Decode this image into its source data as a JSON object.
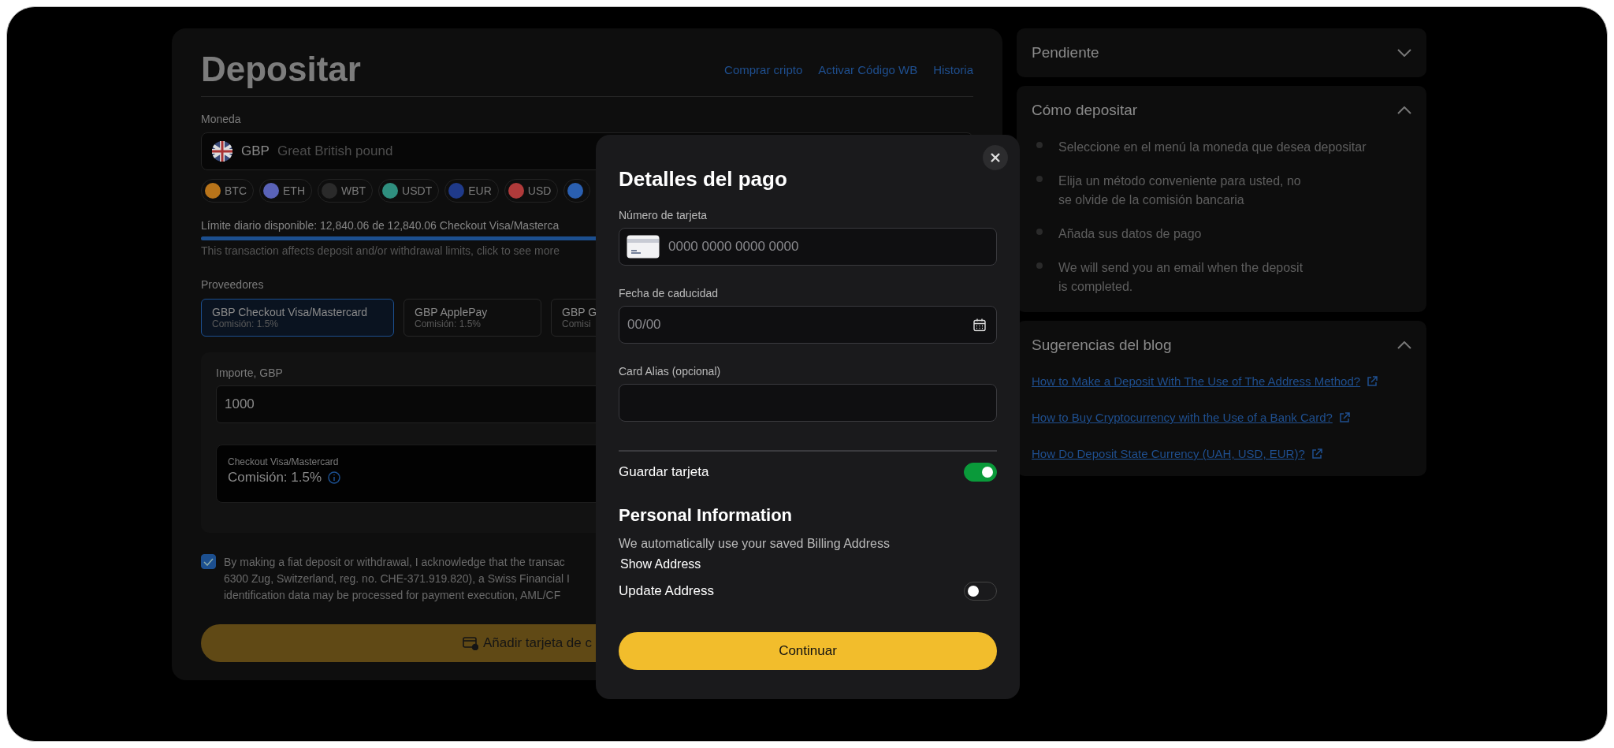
{
  "deposit": {
    "title": "Depositar",
    "links": [
      "Comprar cripto",
      "Activar Código WB",
      "Historia"
    ],
    "currency_label": "Moneda",
    "currency": {
      "code": "GBP",
      "name": "Great British pound"
    },
    "chips": [
      {
        "label": "BTC",
        "color": "#b8741a"
      },
      {
        "label": "ETH",
        "color": "#5a63b8"
      },
      {
        "label": "WBT",
        "color": "#2a2a2a"
      },
      {
        "label": "USDT",
        "color": "#2f8f7f"
      },
      {
        "label": "EUR",
        "color": "#1f3a8a"
      },
      {
        "label": "USD",
        "color": "#b03a3a"
      },
      {
        "color": "#2a5fb0"
      }
    ],
    "limit_text": "Límite diario disponible: 12,840.06 de 12,840.06 Checkout Visa/Masterca",
    "limit": {
      "level": 1
    },
    "limit_note": "This transaction affects deposit and/or withdrawal limits, click to see more",
    "providers_label": "Proveedores",
    "providers": [
      {
        "name": "GBP Checkout Visa/Mastercard",
        "fee": "Comisión: 1.5%",
        "selected": true
      },
      {
        "name": "GBP ApplePay",
        "fee": "Comisión: 1.5%",
        "selected": false
      },
      {
        "name": "GBP G",
        "fee": "Comisi",
        "selected": false
      }
    ],
    "amount_label": "Importe, GBP",
    "amount": "1000",
    "method": {
      "name": "Checkout Visa/Mastercard",
      "fee": "Comisión: 1.5%"
    },
    "consent": {
      "checked": true,
      "lines": [
        "By making a fiat deposit or withdrawal, I acknowledge that the transac",
        "6300 Zug, Switzerland, reg. no. CHE-371.919.820), a Swiss Financial I",
        "identification data may be processed for payment execution, AML/CF"
      ]
    },
    "submit": "Añadir tarjeta de c"
  },
  "sidebar": [
    {
      "kind": "plain",
      "title": "Pendiente",
      "expanded": false
    },
    {
      "kind": "steps",
      "title": "Cómo depositar",
      "expanded": true,
      "items": [
        "Seleccione en el menú la moneda que desea depositar",
        "Elija un método conveniente para usted, no\nse olvide de la comisión bancaria",
        "Añada sus datos de pago",
        "We will send you an email when the deposit\nis completed."
      ]
    },
    {
      "kind": "links",
      "title": "Sugerencias del blog",
      "expanded": true,
      "items": [
        "How to Make a Deposit With The Use of The Address Method?",
        "How to Buy Cryptocurrency with the Use of a Bank Card?",
        "How Do Deposit State Currency (UAH, USD, EUR)?"
      ]
    }
  ],
  "modal": {
    "title": "Detalles del pago",
    "fields": [
      {
        "kind": "card",
        "label": "Número de tarjeta",
        "placeholder": "0000 0000 0000 0000"
      },
      {
        "kind": "date",
        "label": "Fecha de caducidad",
        "placeholder": "00/00"
      },
      {
        "kind": "text",
        "label": "Card Alias (opcional)"
      }
    ],
    "save_card": {
      "label": "Guardar tarjeta",
      "on": true
    },
    "section_title": "Personal Information",
    "info": "We automatically use your saved Billing Address",
    "show_address": "Show Address",
    "update_address": {
      "label": "Update Address",
      "on": false
    },
    "continue": "Continuar"
  }
}
